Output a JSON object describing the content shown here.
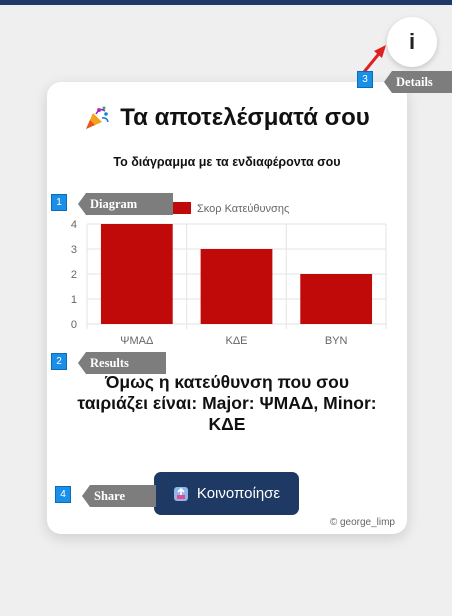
{
  "page": {
    "info_label": "i",
    "title": "Τα αποτελέσματά σου",
    "subtitle": "Το διάγραμμα με τα ενδιαφέροντα σου",
    "result_text": "Όμως η κατεύθυνση που σου ταιριάζει είναι: Major: ΨΜΑΔ, Minor: ΚΔΕ",
    "share_label": "Κοινοποίησε",
    "credit": "© george_limp"
  },
  "annotations": [
    {
      "num": "1",
      "label": "Diagram"
    },
    {
      "num": "2",
      "label": "Results"
    },
    {
      "num": "3",
      "label": "Details"
    },
    {
      "num": "4",
      "label": "Share"
    }
  ],
  "chart_data": {
    "type": "bar",
    "categories": [
      "ΨΜΑΔ",
      "ΚΔΕ",
      "ΒΥΝ"
    ],
    "series": [
      {
        "name": "Σκορ Κατεύθυνσης",
        "values": [
          4,
          3,
          2
        ],
        "color": "#c00a0a"
      }
    ],
    "ylim": [
      0,
      4
    ],
    "yticks": [
      0,
      1,
      2,
      3,
      4
    ],
    "legend": "top",
    "grid": true
  },
  "colors": {
    "top_bar": "#1f3a66",
    "button": "#1e3a64",
    "bar": "#c00a0a",
    "badge": "#1a8fe8",
    "tag": "#7d7d7d"
  }
}
